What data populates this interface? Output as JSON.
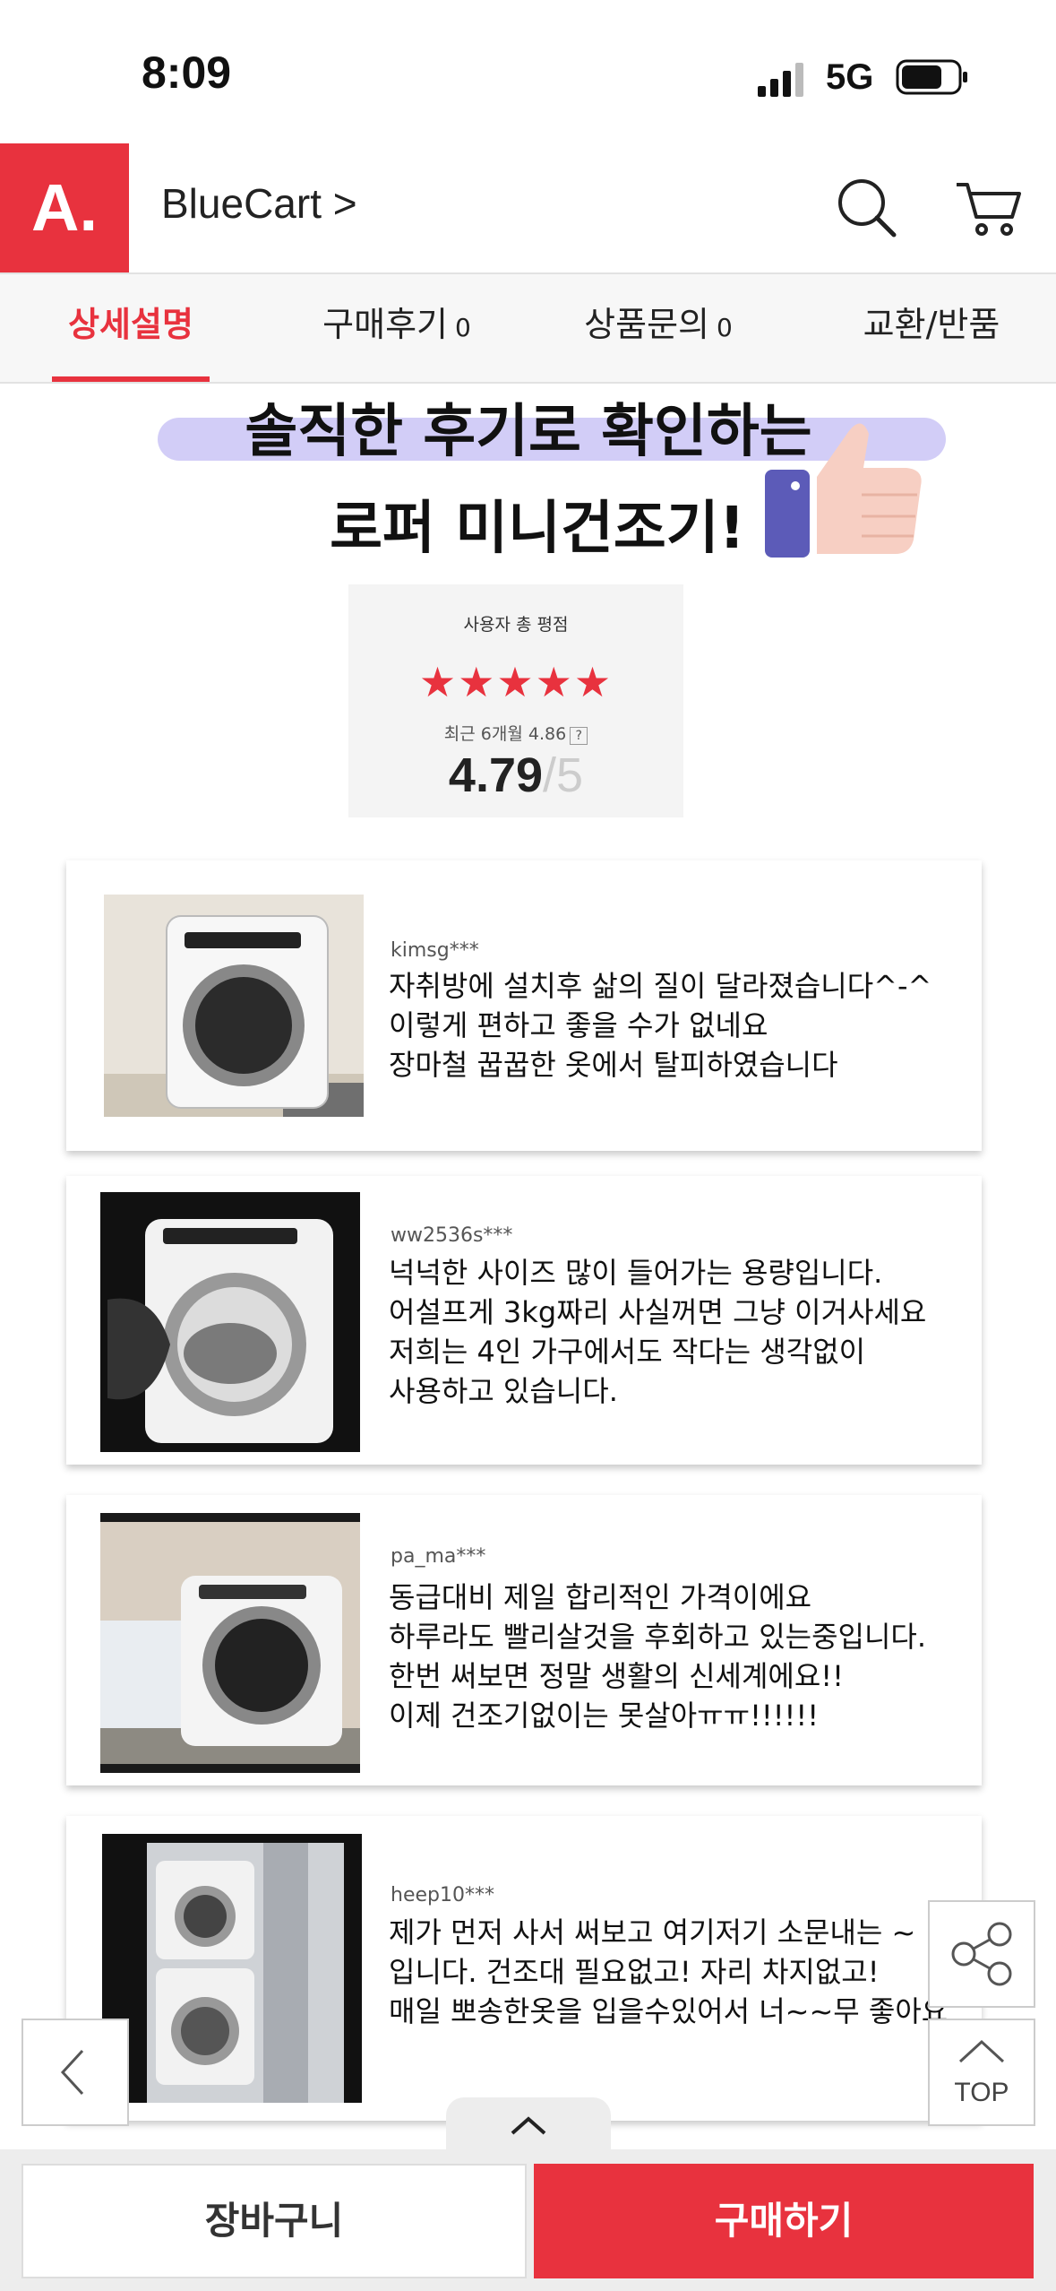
{
  "status": {
    "time": "8:09",
    "network": "5G"
  },
  "header": {
    "logo": "A.",
    "store_name": "BlueCart >"
  },
  "tabs": [
    {
      "label": "상세설명",
      "count": ""
    },
    {
      "label": "구매후기",
      "count": "0"
    },
    {
      "label": "상품문의",
      "count": "0"
    },
    {
      "label": "교환/반품",
      "count": ""
    }
  ],
  "banner": {
    "line1": "솔직한 후기로 확인하는",
    "line2": "로퍼 미니건조기!"
  },
  "rating": {
    "label": "사용자 총 평점",
    "stars": "★★★★★",
    "stars_value": 5,
    "recent_label": "최근 6개월 4.86",
    "help": "?",
    "score": "4.79",
    "total": "/5"
  },
  "reviews": [
    {
      "user": "kimsg***",
      "lines": [
        "자취방에 설치후 삶의 질이 달라졌습니다^-^",
        "이렇게 편하고 좋을 수가 없네요",
        "장마철 꿉꿉한 옷에서 탈피하였습니다"
      ]
    },
    {
      "user": "ww2536s***",
      "lines": [
        "넉넉한 사이즈 많이 들어가는 용량입니다.",
        "어설프게 3kg짜리 사실꺼면 그냥 이거사세요",
        "저희는 4인 가구에서도 작다는 생각없이",
        "사용하고 있습니다."
      ]
    },
    {
      "user": "pa_ma***",
      "lines": [
        "동급대비 제일 합리적인 가격이에요",
        "하루라도 빨리살것을 후회하고 있는중입니다.",
        "한번 써보면 정말 생활의 신세계에요!!",
        "이제 건조기없이는 못살아ㅠㅠ!!!!!!"
      ]
    },
    {
      "user": "heep10***",
      "lines": [
        "제가 먼저 사서 써보고 여기저기 소문내는 ~",
        "입니다. 건조대 필요없고! 자리 차지없고!",
        "매일 뽀송한옷을  입을수있어서 너~~무 좋아요"
      ]
    }
  ],
  "nav": {
    "top_label": "TOP"
  },
  "bottom": {
    "cart_label": "장바구니",
    "buy_label": "구매하기"
  }
}
